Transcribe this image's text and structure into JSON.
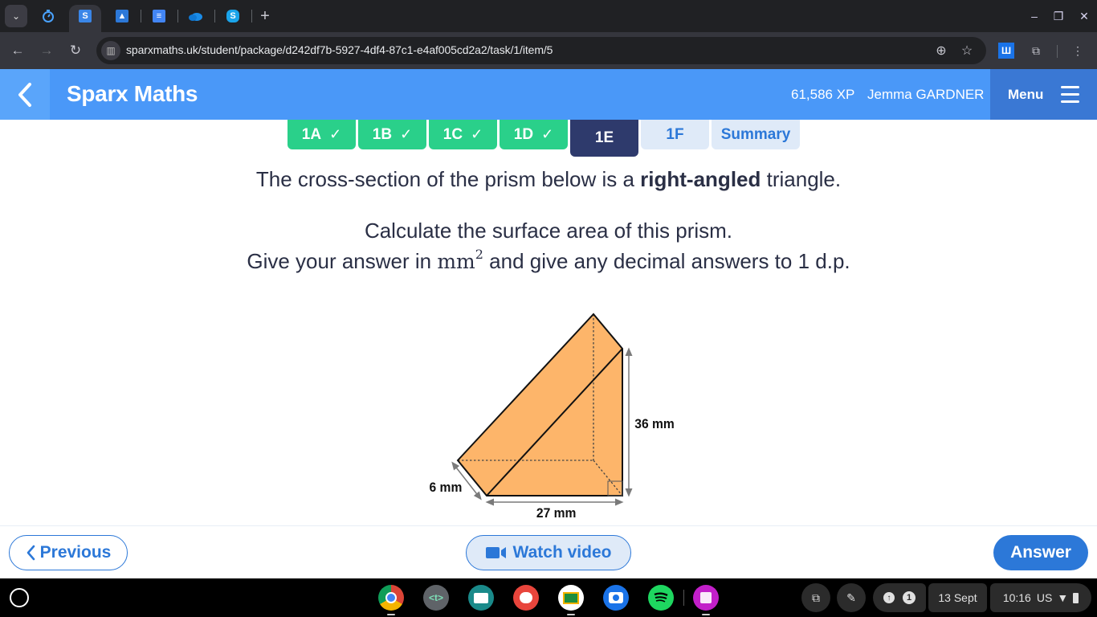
{
  "browser": {
    "tabs": [
      {
        "name": "timer-tab",
        "icon": "stopwatch-icon"
      },
      {
        "name": "sparx-tab",
        "icon": "sparx-s-icon",
        "active": true
      },
      {
        "name": "classroom-tab",
        "icon": "google-classroom-icon"
      },
      {
        "name": "docs-tab",
        "icon": "google-docs-icon"
      },
      {
        "name": "onedrive-tab",
        "icon": "onedrive-icon"
      },
      {
        "name": "skype-tab",
        "icon": "skype-icon"
      }
    ],
    "new_tab_label": "+",
    "url": "sparxmaths.uk/student/package/d242df7b-5927-4df4-87c1-e4af005cd2a2/task/1/item/5",
    "extension_badge": "Ш"
  },
  "header": {
    "title": "Sparx Maths",
    "xp": "61,586 XP",
    "user": "Jemma GARDNER",
    "menu_label": "Menu"
  },
  "task_tabs": [
    {
      "label": "1A",
      "state": "done",
      "check": "✓"
    },
    {
      "label": "1B",
      "state": "done",
      "check": "✓"
    },
    {
      "label": "1C",
      "state": "done",
      "check": "✓"
    },
    {
      "label": "1D",
      "state": "done",
      "check": "✓"
    },
    {
      "label": "1E",
      "state": "current"
    },
    {
      "label": "1F",
      "state": "todo"
    },
    {
      "label": "Summary",
      "state": "todo"
    }
  ],
  "question": {
    "line1_pre": "The cross-section of the prism below is a ",
    "line1_bold": "right-angled",
    "line1_post": " triangle.",
    "line2": "Calculate the surface area of this prism.",
    "line3_pre": "Give your answer in ",
    "unit": "mm",
    "unit_power": "2",
    "line3_post": " and give any decimal answers to 1 d.p."
  },
  "diagram": {
    "fill_color": "#fdb56a",
    "labels": {
      "height": "36 mm",
      "base": "27 mm",
      "depth": "6 mm"
    }
  },
  "footer": {
    "previous_label": "Previous",
    "watch_video_label": "Watch video",
    "answer_label": "Answer"
  },
  "shelf": {
    "apps": [
      "chrome-icon",
      "text-editor-icon",
      "news-icon",
      "paint-icon",
      "google-classroom-icon",
      "camera-icon",
      "spotify-icon",
      "gallery-icon"
    ],
    "notification_count": "1",
    "date": "13 Sept",
    "time": "10:16",
    "locale": "US"
  }
}
